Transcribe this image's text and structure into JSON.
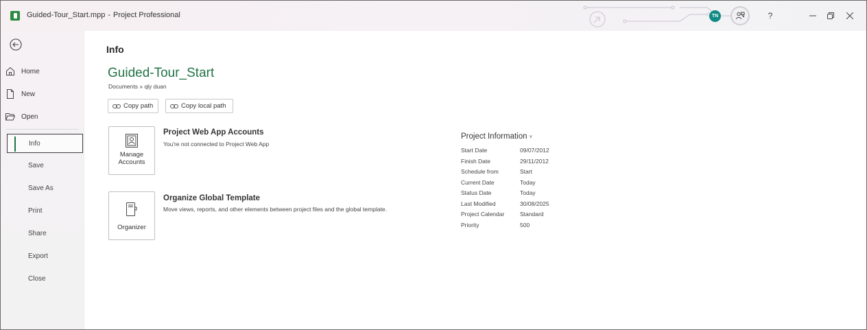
{
  "window": {
    "file_name": "Guided-Tour_Start.mpp",
    "separator": "-",
    "app_name": "Project Professional",
    "user_initials": "TN",
    "help_label": "?"
  },
  "nav": {
    "top_items": [
      {
        "label": "Home",
        "icon": "home-icon"
      },
      {
        "label": "New",
        "icon": "new-document-icon"
      },
      {
        "label": "Open",
        "icon": "folder-open-icon"
      }
    ],
    "sub_items": [
      {
        "label": "Info",
        "active": true
      },
      {
        "label": "Save"
      },
      {
        "label": "Save As"
      },
      {
        "label": "Print"
      },
      {
        "label": "Share"
      },
      {
        "label": "Export"
      },
      {
        "label": "Close"
      }
    ]
  },
  "main": {
    "title": "Info",
    "project_name": "Guided-Tour_Start",
    "breadcrumb": "Documents » qly duan",
    "copy_path": "Copy path",
    "copy_local_path": "Copy local path",
    "accounts": {
      "tile_label_line1": "Manage",
      "tile_label_line2": "Accounts",
      "title": "Project Web App Accounts",
      "description": "You're not connected to Project Web App"
    },
    "organizer": {
      "tile_label": "Organizer",
      "title": "Organize Global Template",
      "description": "Move views, reports, and other elements between project files and the global template."
    }
  },
  "project_info": {
    "heading": "Project Information",
    "caret": "˅",
    "rows": [
      {
        "key": "Start Date",
        "value": "09/07/2012"
      },
      {
        "key": "Finish Date",
        "value": "29/11/2012"
      },
      {
        "key": "Schedule from",
        "value": "Start"
      },
      {
        "key": "Current Date",
        "value": "Today"
      },
      {
        "key": "Status Date",
        "value": "Today"
      },
      {
        "key": "Last Modified",
        "value": "30/08/2025"
      },
      {
        "key": "Project Calendar",
        "value": "Standard"
      },
      {
        "key": "Priority",
        "value": "500"
      }
    ]
  },
  "colors": {
    "accent": "#217346",
    "avatar": "#0f8a85",
    "app_icon": "#2a8a3e"
  }
}
